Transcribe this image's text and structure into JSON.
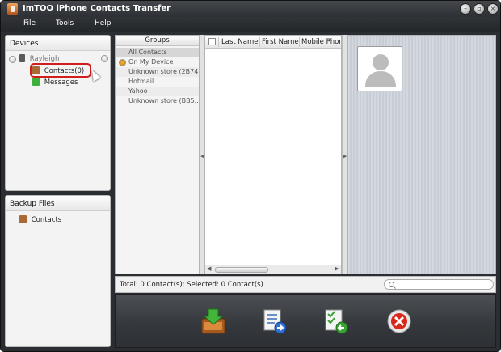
{
  "app": {
    "title": "ImTOO iPhone Contacts Transfer"
  },
  "window_buttons": [
    "minimize-icon",
    "maximize-icon",
    "close-icon"
  ],
  "menu": [
    "File",
    "Tools",
    "Help"
  ],
  "devices": {
    "header": "Devices",
    "device_name": "Rayleigh",
    "items": [
      {
        "label": "Contacts(0)",
        "icon": "contacts-icon",
        "selected": true
      },
      {
        "label": "Messages",
        "icon": "messages-icon",
        "selected": false
      }
    ]
  },
  "backup": {
    "header": "Backup Files",
    "items": [
      {
        "label": "Contacts",
        "icon": "contacts-icon"
      }
    ]
  },
  "groups": {
    "header": "Groups",
    "items": [
      "All Contacts",
      "On My Device",
      "Unknown store (2B74...",
      "Hotmail",
      "Yahoo",
      "Unknown store (BB5..."
    ]
  },
  "table": {
    "columns": [
      "Last Name",
      "First Name",
      "Mobile Phone"
    ],
    "rows": []
  },
  "status": {
    "text": "Total: 0 Contact(s); Selected: 0 Contact(s)",
    "search_placeholder": ""
  },
  "toolbar": [
    "import-icon",
    "export-to-computer-icon",
    "export-to-device-icon",
    "delete-icon"
  ],
  "colors": {
    "highlight": "#d01e1e",
    "toolbar_bg": "#35383c",
    "title_bg": "#2c2f33"
  }
}
